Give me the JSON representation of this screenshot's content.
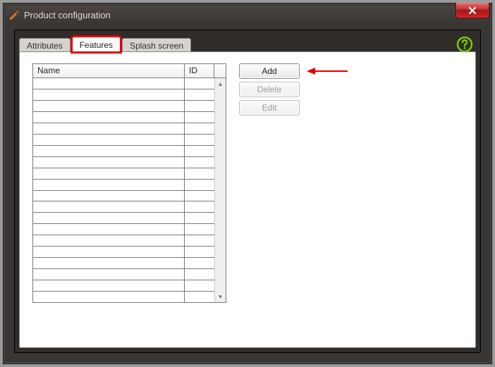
{
  "window": {
    "title": "Product configuration"
  },
  "tabs": {
    "items": [
      {
        "label": "Attributes",
        "active": false,
        "highlight": false
      },
      {
        "label": "Features",
        "active": true,
        "highlight": true
      },
      {
        "label": "Splash screen",
        "active": false,
        "highlight": false
      }
    ]
  },
  "grid": {
    "columns": {
      "name": "Name",
      "id": "ID"
    },
    "row_count": 20
  },
  "buttons": {
    "add": {
      "label": "Add",
      "enabled": true
    },
    "delete": {
      "label": "Delete",
      "enabled": false
    },
    "edit": {
      "label": "Edit",
      "enabled": false
    }
  },
  "annotation": {
    "arrow_color": "#e20000",
    "highlight_color": "#e20000"
  },
  "help_color": "#7ac900"
}
